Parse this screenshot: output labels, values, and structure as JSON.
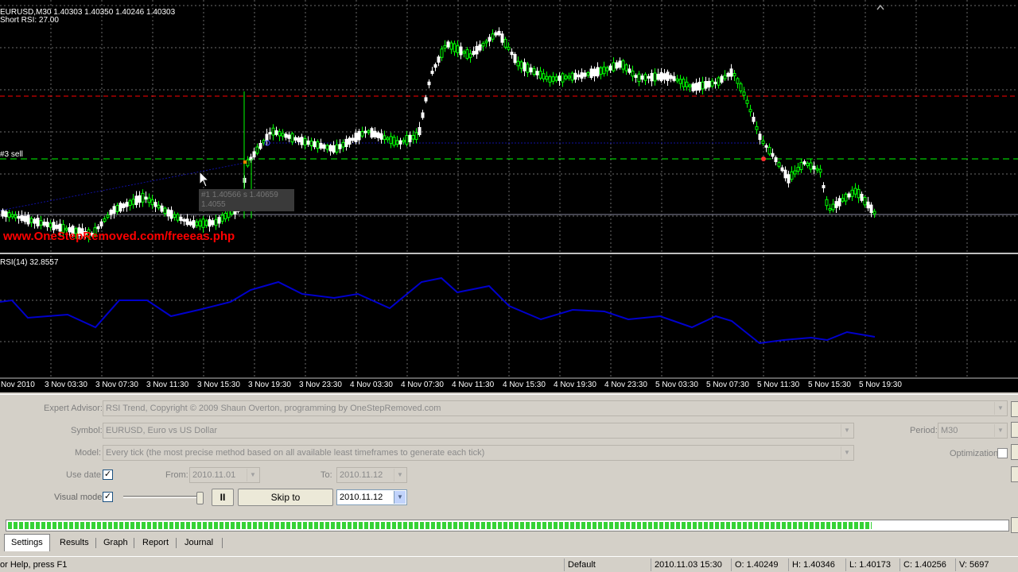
{
  "chart": {
    "header_line": "EURUSD,M30  1.40303 1.40350 1.40246 1.40303",
    "indicator_line": "Short RSI: 27.00",
    "sell_label": "#3 sell",
    "tooltip_line1": "#1 1.40566 s 1.40659",
    "tooltip_line2": "1.4055",
    "watermark": "www.OneStepRemoved.com/freeeas.php",
    "rsi_label": "RSI(14) 32.8557",
    "colors": {
      "bull_candle": "#00ff00",
      "bear_candle": "#ffffff",
      "rsi_line": "#0000cc",
      "grid": "#6b6b6b",
      "sell_level": "#00ff00",
      "red_level": "#ff0000"
    }
  },
  "time_axis": [
    "Nov 2010",
    "3 Nov 03:30",
    "3 Nov 07:30",
    "3 Nov 11:30",
    "3 Nov 15:30",
    "3 Nov 19:30",
    "3 Nov 23:30",
    "4 Nov 03:30",
    "4 Nov 07:30",
    "4 Nov 11:30",
    "4 Nov 15:30",
    "4 Nov 19:30",
    "4 Nov 23:30",
    "5 Nov 03:30",
    "5 Nov 07:30",
    "5 Nov 11:30",
    "5 Nov 15:30",
    "5 Nov 19:30"
  ],
  "tester": {
    "expert_label": "Expert Advisor:",
    "expert_value": "RSI Trend, Copyright © 2009 Shaun Overton, programming by OneStepRemoved.com",
    "symbol_label": "Symbol:",
    "symbol_value": "EURUSD, Euro vs US Dollar",
    "period_label": "Period:",
    "period_value": "M30",
    "model_label": "Model:",
    "model_value": "Every tick (the most precise method based on all available least timeframes to generate each tick)",
    "optimization_label": "Optimization",
    "use_date_label": "Use date",
    "from_label": "From:",
    "from_value": "2010.11.01",
    "to_label": "To:",
    "to_value": "2010.11.12",
    "visual_mode_label": "Visual mode",
    "pause_label": "II",
    "skip_to_label": "Skip to",
    "skip_date_value": "2010.11.12",
    "progress": 0.865
  },
  "tabs": [
    "Settings",
    "Results",
    "Graph",
    "Report",
    "Journal"
  ],
  "status": {
    "help": "or Help, press F1",
    "profile": "Default",
    "datetime": "2010.11.03 15:30",
    "open": "O: 1.40249",
    "high": "H: 1.40346",
    "low": "L: 1.40173",
    "close": "C: 1.40256",
    "volume": "V: 5697"
  }
}
